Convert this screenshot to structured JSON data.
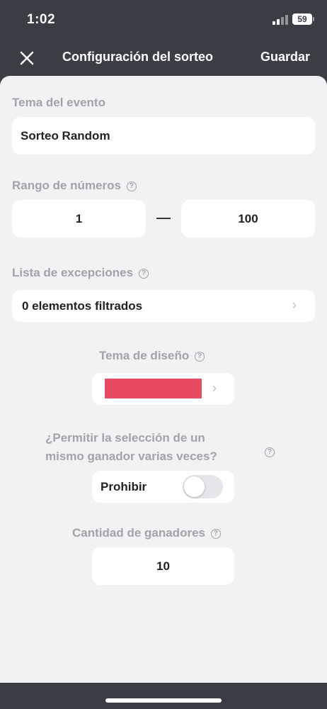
{
  "status": {
    "time": "1:02",
    "battery": "59"
  },
  "nav": {
    "title": "Configuración del sorteo",
    "save_label": "Guardar"
  },
  "event_topic": {
    "label": "Tema del evento",
    "value": "Sorteo Random"
  },
  "number_range": {
    "label": "Rango de números",
    "min": "1",
    "max": "100"
  },
  "exceptions": {
    "label": "Lista de excepciones",
    "value": "0 elementos filtrados"
  },
  "design_theme": {
    "label": "Tema de diseño",
    "color": "#e84a64"
  },
  "repeat_winner": {
    "question_line1": "¿Permitir la selección de un",
    "question_line2": "mismo ganador varias veces?",
    "option_label": "Prohibir",
    "enabled": false
  },
  "winners_count": {
    "label": "Cantidad de ganadores",
    "value": "10"
  },
  "colors": {
    "background": "#3a3d44",
    "sheet": "#f2f2f4",
    "accent": "#e84a64"
  }
}
